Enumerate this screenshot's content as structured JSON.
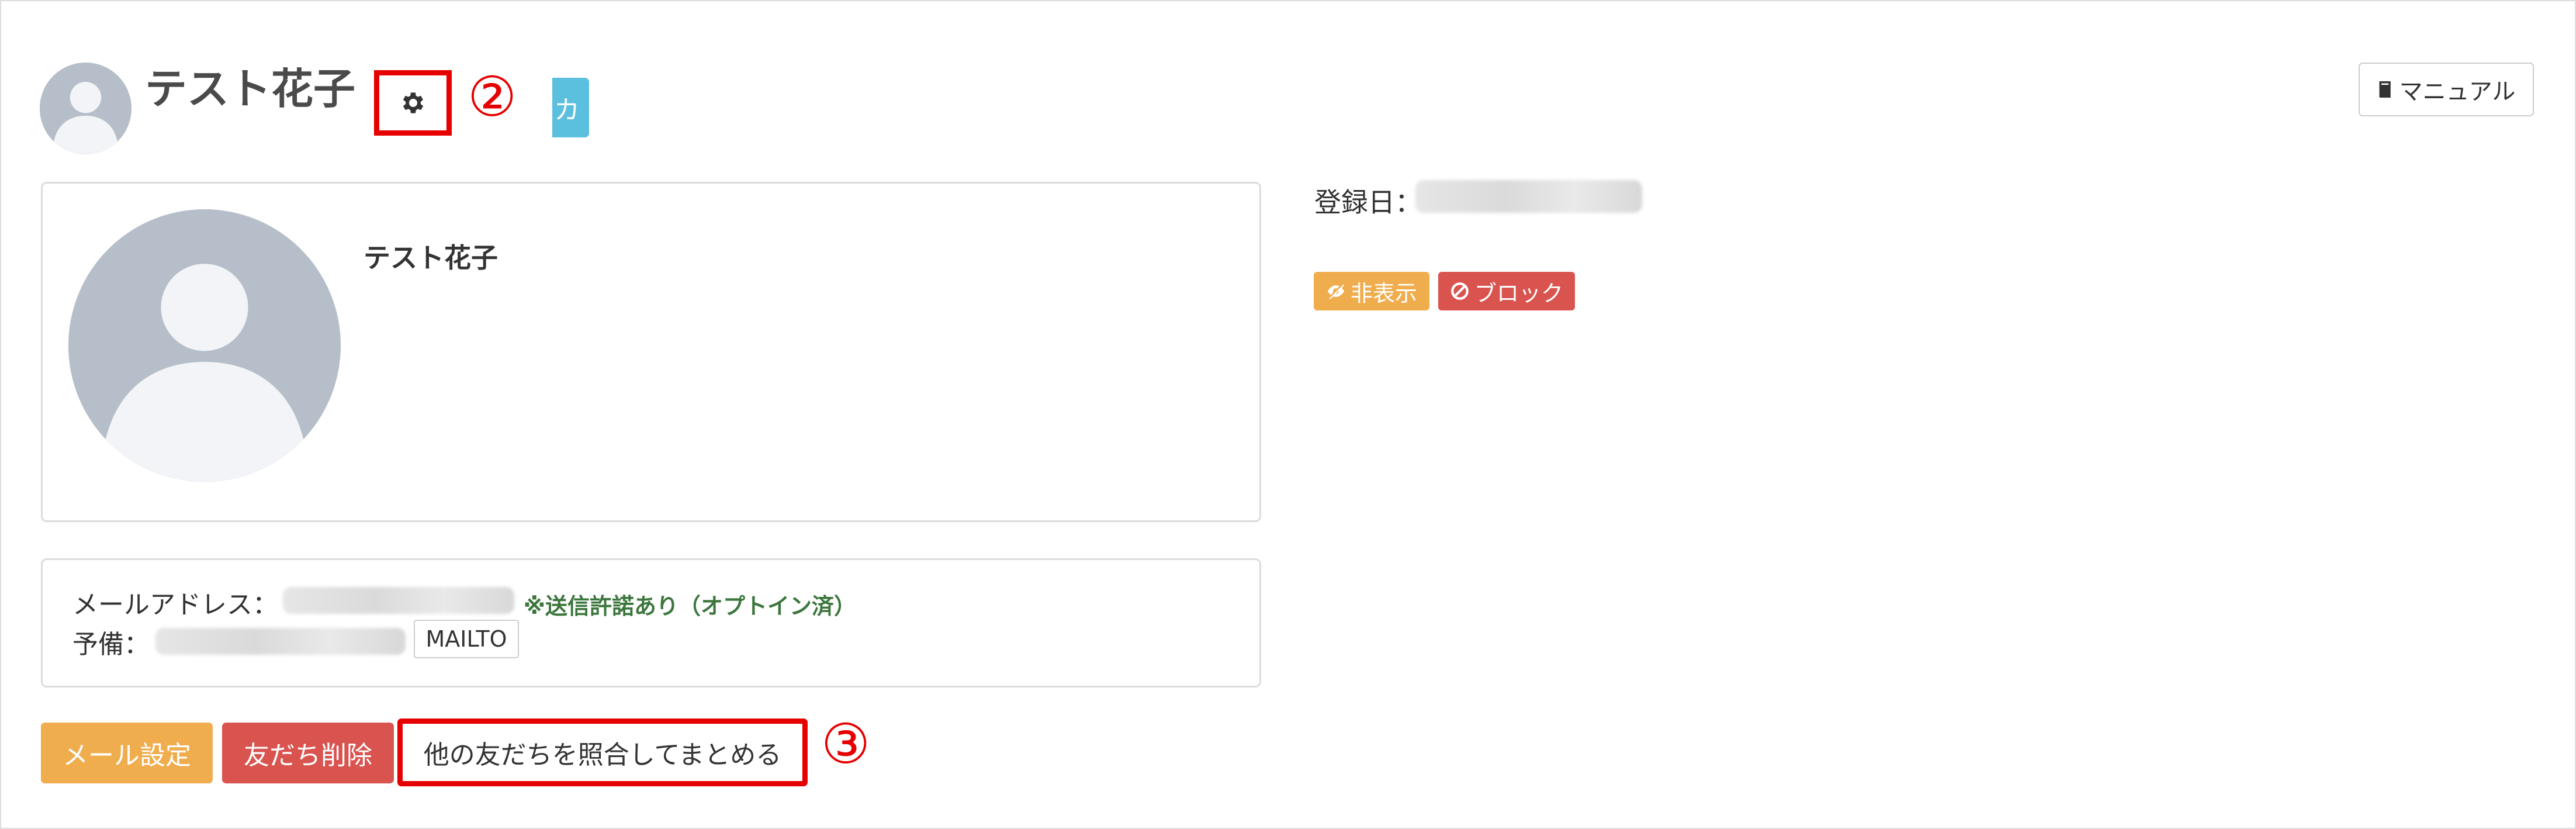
{
  "header": {
    "title": "テスト花子",
    "callout_2": "②",
    "callout_3": "③",
    "hidden_button_glyph": "カ",
    "manual_label": "マニュアル"
  },
  "profile": {
    "name": "テスト花子",
    "registered_label": "登録日："
  },
  "badges": {
    "hide_label": "非表示",
    "block_label": "ブロック"
  },
  "contact": {
    "email_label": "メールアドレス：",
    "optin_note": "※送信許諾あり（オプトイン済）",
    "spare_label": "予備：",
    "mailto_label": "MAILTO"
  },
  "actions": {
    "mail_settings": "メール設定",
    "delete_friend": "友だち削除",
    "merge_friends": "他の友だちを照合してまとめる"
  },
  "colors": {
    "accent_red": "#e60000",
    "warning": "#f0ad4e",
    "danger": "#d9534f",
    "info": "#5bc0de",
    "success_text": "#3c763d"
  },
  "icons": [
    "user-silhouette-icon",
    "gear-icon",
    "book-icon",
    "eye-slash-icon",
    "ban-icon"
  ]
}
